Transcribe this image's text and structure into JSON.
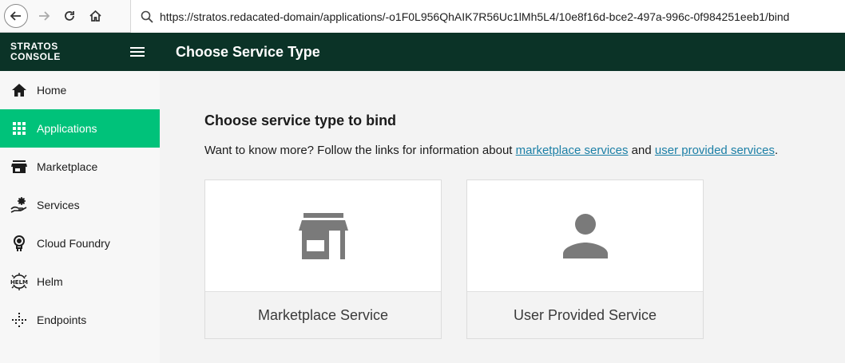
{
  "browser": {
    "url": "https://stratos.redacated-domain/applications/-o1F0L956QhAIK7R56Uc1lMh5L4/10e8f16d-bce2-497a-996c-0f984251eeb1/bind",
    "icons": [
      "back-arrow-icon",
      "forward-arrow-icon",
      "reload-icon",
      "home-icon",
      "search-icon"
    ]
  },
  "app": {
    "logo_line1": "STRATOS",
    "logo_line2": "CONSOLE",
    "page_title": "Choose Service Type"
  },
  "sidebar": {
    "items": [
      {
        "label": "Home",
        "icon": "home-icon",
        "active": false
      },
      {
        "label": "Applications",
        "icon": "apps-grid-icon",
        "active": true
      },
      {
        "label": "Marketplace",
        "icon": "store-icon",
        "active": false
      },
      {
        "label": "Services",
        "icon": "services-icon",
        "active": false
      },
      {
        "label": "Cloud Foundry",
        "icon": "cloud-foundry-icon",
        "active": false
      },
      {
        "label": "Helm",
        "icon": "helm-icon",
        "active": false
      },
      {
        "label": "Endpoints",
        "icon": "endpoints-icon",
        "active": false
      }
    ],
    "active_color": "#00c27a"
  },
  "main": {
    "heading": "Choose service type to bind",
    "info_prefix": "Want to know more? Follow the links for information about ",
    "link_marketplace": "marketplace services",
    "info_and": " and ",
    "link_user_provided": "user provided services",
    "info_suffix": ".",
    "cards": [
      {
        "label": "Marketplace Service",
        "icon": "store-icon"
      },
      {
        "label": "User Provided Service",
        "icon": "person-icon"
      }
    ]
  },
  "colors": {
    "header_bg": "#0b3327",
    "link": "#1b7fa6"
  }
}
